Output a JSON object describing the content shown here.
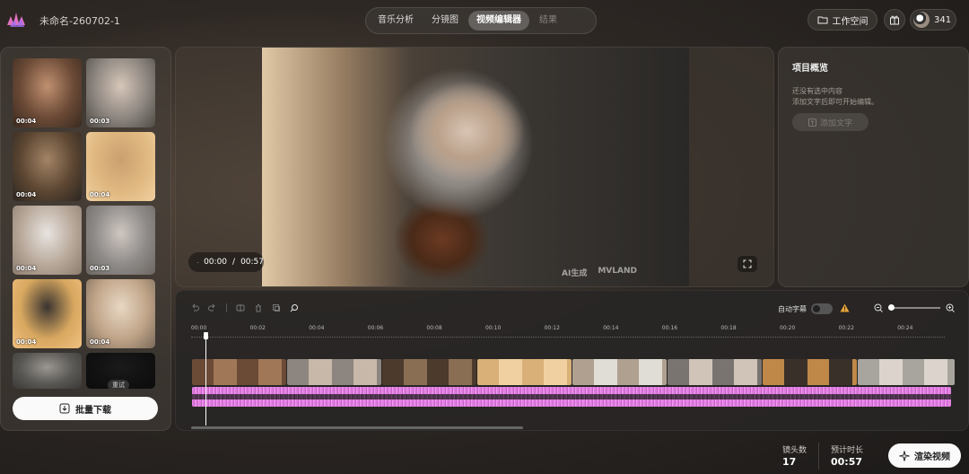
{
  "header": {
    "project_title": "未命名-260702-1",
    "tabs": [
      {
        "label": "音乐分析",
        "state": "normal"
      },
      {
        "label": "分镜图",
        "state": "normal"
      },
      {
        "label": "视频编辑器",
        "state": "active"
      },
      {
        "label": "结果",
        "state": "disabled"
      }
    ],
    "workspace_label": "工作空间",
    "credits": "341"
  },
  "left_panel": {
    "thumbnails": [
      {
        "duration": "00:04",
        "colors": [
          "#6b4a36",
          "#c09070",
          "#3a2a20"
        ]
      },
      {
        "duration": "00:03",
        "colors": [
          "#8d8680",
          "#d6c6b8",
          "#4f4a45"
        ]
      },
      {
        "duration": "00:04",
        "colors": [
          "#5c4632",
          "#a38466",
          "#2c2620"
        ]
      },
      {
        "duration": "00:04",
        "colors": [
          "#e0b880",
          "#caa070",
          "#f0d0a0"
        ]
      },
      {
        "duration": "00:04",
        "colors": [
          "#b8a89a",
          "#e8e4e0",
          "#8a7c6e"
        ]
      },
      {
        "duration": "00:03",
        "colors": [
          "#8d8a88",
          "#cfc6c0",
          "#6c6660"
        ]
      },
      {
        "duration": "00:04",
        "colors": [
          "#d8a860",
          "#3a3430",
          "#f0c080"
        ]
      },
      {
        "duration": "00:04",
        "colors": [
          "#c0a488",
          "#e8d8c4",
          "#7a6a5a"
        ]
      },
      {
        "duration": "",
        "colors": [
          "#5a5854",
          "#9a9692",
          "#3a3836"
        ]
      },
      {
        "duration": "",
        "colors": [
          "#111111",
          "#1a1a1a",
          "#0c0c0c"
        ]
      }
    ],
    "retry_label": "重试",
    "batch_download_label": "批量下载"
  },
  "preview": {
    "time_current": "00:00",
    "time_separator": "/",
    "time_total": "00:57",
    "watermark_left": "AI生成",
    "watermark_right": "MVLAND"
  },
  "project_overview": {
    "title": "项目概览",
    "hint_line1": "还没有选中内容",
    "hint_line2": "添加文字后即可开始编辑。",
    "add_text_label": "添加文字"
  },
  "timeline": {
    "auto_subtitle_label": "自动字幕",
    "auto_subtitle_on": false,
    "zoom_level": 0,
    "ticks": [
      "00:00",
      "00:02",
      "00:04",
      "00:06",
      "00:08",
      "00:10",
      "00:12",
      "00:14",
      "00:16",
      "00:18",
      "00:20",
      "00:22",
      "00:24"
    ],
    "clips": [
      {
        "duration_s": 3.2,
        "colors": [
          "#6b4a36",
          "#a07858"
        ]
      },
      {
        "duration_s": 3.2,
        "colors": [
          "#8d8680",
          "#c8b8aa"
        ]
      },
      {
        "duration_s": 3.2,
        "colors": [
          "#4c3a2c",
          "#8a6e54"
        ]
      },
      {
        "duration_s": 3.2,
        "colors": [
          "#d8b078",
          "#f0d0a0"
        ]
      },
      {
        "duration_s": 3.2,
        "colors": [
          "#b0a090",
          "#e0dcd6"
        ]
      },
      {
        "duration_s": 3.2,
        "colors": [
          "#7a7470",
          "#d0c4b8"
        ]
      },
      {
        "duration_s": 3.2,
        "colors": [
          "#c08848",
          "#3a302a"
        ]
      },
      {
        "duration_s": 3.3,
        "colors": [
          "#a8a49e",
          "#dcd4cc"
        ]
      }
    ]
  },
  "stats": {
    "shots_label": "镜头数",
    "shots_value": "17",
    "duration_label": "预计时长",
    "duration_value": "00:57",
    "render_label": "渲染视频"
  }
}
